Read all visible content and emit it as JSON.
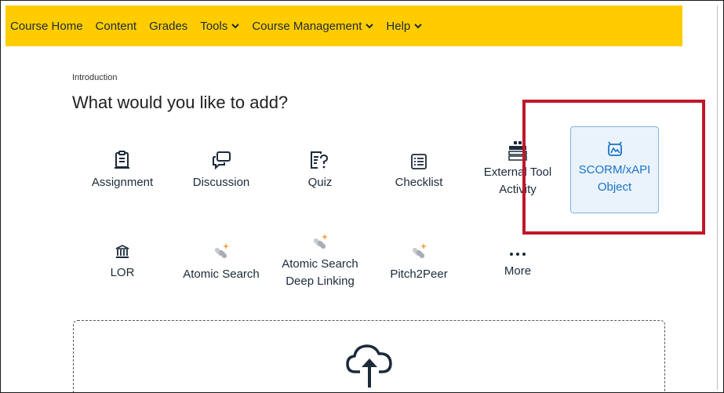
{
  "nav": {
    "items": [
      {
        "label": "Course Home",
        "dropdown": false
      },
      {
        "label": "Content",
        "dropdown": false
      },
      {
        "label": "Grades",
        "dropdown": false
      },
      {
        "label": "Tools",
        "dropdown": true
      },
      {
        "label": "Course Management",
        "dropdown": true
      },
      {
        "label": "Help",
        "dropdown": true
      }
    ]
  },
  "breadcrumb": "Introduction",
  "heading": "What would you like to add?",
  "tools_row1": [
    {
      "label": "Assignment",
      "icon": "assignment-icon"
    },
    {
      "label": "Discussion",
      "icon": "discussion-icon"
    },
    {
      "label": "Quiz",
      "icon": "quiz-icon"
    },
    {
      "label": "Checklist",
      "icon": "checklist-icon"
    },
    {
      "label": "External Tool Activity",
      "icon": "external-tool-icon"
    }
  ],
  "scorm": {
    "label": "SCORM/xAPI Object",
    "icon": "scorm-icon"
  },
  "tools_row2": [
    {
      "label": "LOR",
      "icon": "lor-icon"
    },
    {
      "label": "Atomic Search",
      "icon": "atomic-search-icon"
    },
    {
      "label": "Atomic Search Deep Linking",
      "icon": "atomic-search-deep-linking-icon"
    },
    {
      "label": "Pitch2Peer",
      "icon": "pitch2peer-icon"
    },
    {
      "label": "More",
      "icon": "more-icon"
    }
  ],
  "upload": {
    "icon": "cloud-upload-icon"
  },
  "colors": {
    "nav_bg": "#ffcc00",
    "accent": "#1a73c8",
    "highlight": "#c0182b"
  }
}
